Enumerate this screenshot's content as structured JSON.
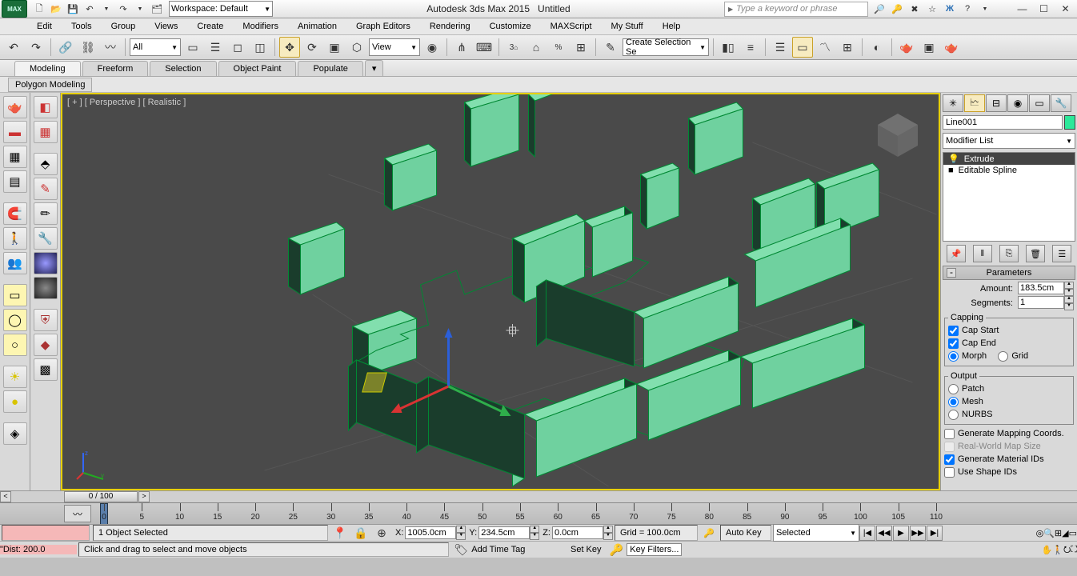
{
  "title": {
    "app": "Autodesk 3ds Max 2015",
    "doc": "Untitled"
  },
  "workspace": {
    "label": "Workspace: Default"
  },
  "search": {
    "placeholder": "Type a keyword or phrase"
  },
  "menu": [
    "Edit",
    "Tools",
    "Group",
    "Views",
    "Create",
    "Modifiers",
    "Animation",
    "Graph Editors",
    "Rendering",
    "Customize",
    "MAXScript",
    "My Stuff",
    "Help"
  ],
  "toolbar": {
    "filter": "All",
    "refsys": "View",
    "selset": "Create Selection Se"
  },
  "ribbon": {
    "tabs": [
      "Modeling",
      "Freeform",
      "Selection",
      "Object Paint",
      "Populate"
    ],
    "panel": "Polygon Modeling"
  },
  "viewport": {
    "label": "[ + ] [ Perspective ] [ Realistic ]"
  },
  "cmd": {
    "name": "Line001",
    "modlist": "Modifier List",
    "stack": [
      {
        "icon": "💡",
        "label": "Extrude",
        "sel": true
      },
      {
        "icon": "■",
        "label": "Editable Spline",
        "sel": false
      }
    ],
    "roll": "Parameters",
    "amount": {
      "lbl": "Amount:",
      "val": "183.5cm"
    },
    "segments": {
      "lbl": "Segments:",
      "val": "1"
    },
    "capping": {
      "legend": "Capping",
      "capstart": "Cap Start",
      "capend": "Cap End",
      "morph": "Morph",
      "grid": "Grid"
    },
    "output": {
      "legend": "Output",
      "patch": "Patch",
      "mesh": "Mesh",
      "nurbs": "NURBS"
    },
    "gm": "Generate Mapping Coords.",
    "rw": "Real-World Map Size",
    "gid": "Generate Material IDs",
    "usid": "Use Shape IDs"
  },
  "time": {
    "slider": "0 / 100",
    "ticks": [
      0,
      5,
      10,
      15,
      20,
      25,
      30,
      35,
      40,
      45,
      50,
      55,
      60,
      65,
      70,
      75,
      80,
      85,
      90,
      95,
      100,
      105,
      110
    ]
  },
  "status": {
    "sel": "1 Object Selected",
    "x": "1005.0cm",
    "y": "234.5cm",
    "z": "0.0cm",
    "grid": "Grid = 100.0cm",
    "autokey": "Auto Key",
    "setkey": "Set Key",
    "selected": "Selected",
    "keyfilters": "Key Filters...",
    "addtag": "Add Time Tag",
    "dist": "\"Dist: 200.0",
    "prompt": "Click and drag to select and move objects"
  }
}
